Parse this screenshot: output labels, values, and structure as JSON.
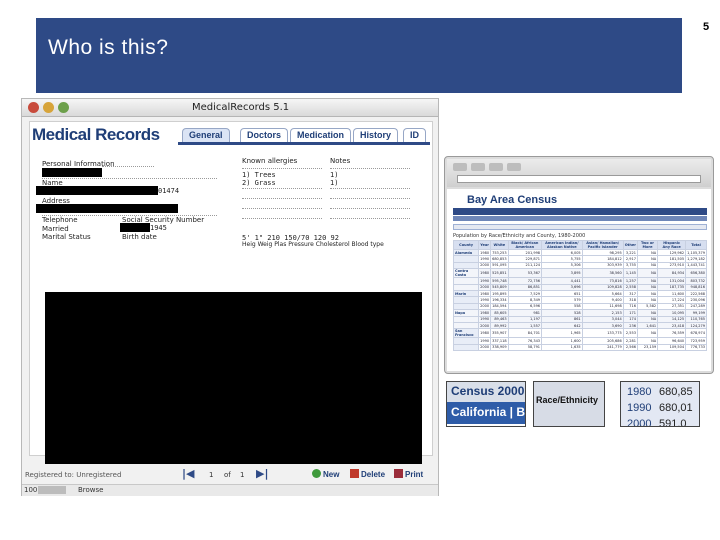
{
  "slide": {
    "title": "Who is this?",
    "page_number": "5",
    "accent_color": "#2e4a86"
  },
  "medical_records": {
    "window_title": "MedicalRecords 5.1",
    "logo": "Medical Records",
    "tabs": [
      "General",
      "Doctors",
      "Medication",
      "History",
      "ID"
    ],
    "active_tab": "General",
    "fields": {
      "personal_info": "Personal Information",
      "name": "Name",
      "address": "Address",
      "telephone": "Telephone",
      "ssn": "Social Security Number",
      "married": "Married",
      "marital_status": "Marital Status",
      "birth_date": "Birth date",
      "known_allergies": "Known allergies",
      "notes": "Notes"
    },
    "values": {
      "name_suffix": "01474",
      "allergy_1": "1) Trees",
      "allergy_2": "2) Grass",
      "note_1": "1)",
      "note_2": "1)",
      "birth_suffix": "1945",
      "vitals_line": "5' 1\"    210    150/70    120    92",
      "vitals_labels": "Heig  Weig  Plas Pressure Cholesterol  Blood type"
    },
    "status": "Registered to: Unregistered",
    "pager": {
      "first_icon": "first-page-icon",
      "current": "1",
      "of": "of",
      "total": "1"
    },
    "actions": {
      "new": "New",
      "delete": "Delete",
      "print": "Print"
    },
    "bottom": {
      "zoom": "100",
      "mode": "Browse"
    }
  },
  "browser": {
    "site_logo": "Bay Area Census",
    "subtitle": "Population by Race/Ethnicity and County, 1980-2000",
    "table_headers": [
      "County",
      "Year",
      "White",
      "Black/ African American",
      "American Indian/ Alaskan Native",
      "Asian/ Hawaiian/ Pacific Islander",
      "Other",
      "Two or More",
      "Hispanic Any Race",
      "Total"
    ],
    "table_rows": [
      [
        "Alameda",
        "1980",
        "753,253",
        "201,998",
        "6,005",
        "98,295",
        "3,221",
        "NA",
        "129,962",
        "1,105,379"
      ],
      [
        "",
        "1990",
        "680,853",
        "229,871",
        "5,755",
        "184,812",
        "2,917",
        "NA",
        "181,505",
        "1,279,182"
      ],
      [
        "",
        "2000",
        "591,095",
        "211,124",
        "5,306",
        "303,939",
        "3,755",
        "NA",
        "273,910",
        "1,443,741"
      ],
      [
        "Contra Costa",
        "1980",
        "525,851",
        "53,367",
        "3,895",
        "38,560",
        "1,145",
        "NA",
        "84,934",
        "656,380"
      ],
      [
        "",
        "1990",
        "595,748",
        "72,756",
        "4,441",
        "73,816",
        "1,257",
        "NA",
        "131,004",
        "803,732"
      ],
      [
        "",
        "2000",
        "545,809",
        "86,851",
        "3,696",
        "109,828",
        "2,558",
        "NA",
        "187,735",
        "948,816"
      ],
      [
        "Marin",
        "1980",
        "195,895",
        "7,529",
        "651",
        "5,664",
        "317",
        "NA",
        "11,600",
        "222,568"
      ],
      [
        "",
        "1990",
        "196,334",
        "8,349",
        "579",
        "9,400",
        "318",
        "NA",
        "17,224",
        "230,096"
      ],
      [
        "",
        "2000",
        "184,594",
        "6,596",
        "558",
        "11,698",
        "716",
        "5,582",
        "27,351",
        "247,289"
      ],
      [
        "Napa",
        "1980",
        "85,605",
        "981",
        "528",
        "2,153",
        "171",
        "NA",
        "10,095",
        "99,199"
      ],
      [
        "",
        "1990",
        "89,463",
        "1,197",
        "861",
        "3,044",
        "174",
        "NA",
        "14,125",
        "110,765"
      ],
      [
        "",
        "2000",
        "89,992",
        "1,557",
        "642",
        "3,690",
        "236",
        "1,641",
        "23,418",
        "124,279"
      ],
      [
        "San Francisco",
        "1980",
        "355,907",
        "84,701",
        "1,965",
        "133,775",
        "2,553",
        "NA",
        "76,559",
        "678,974"
      ],
      [
        "",
        "1990",
        "337,118",
        "76,343",
        "1,600",
        "205,686",
        "2,281",
        "NA",
        "96,640",
        "723,959"
      ],
      [
        "",
        "2000",
        "338,909",
        "58,791",
        "1,635",
        "241,779",
        "2,566",
        "23,159",
        "109,504",
        "776,733"
      ]
    ]
  },
  "zooms": {
    "census_top": "Census 2000",
    "census_bottom": "California | B",
    "race": "Race/Ethnicity",
    "years": [
      {
        "year": "1980",
        "value": "680,85"
      },
      {
        "year": "1990",
        "value": "680,01"
      },
      {
        "year": "2000",
        "value": "591,0"
      }
    ]
  }
}
